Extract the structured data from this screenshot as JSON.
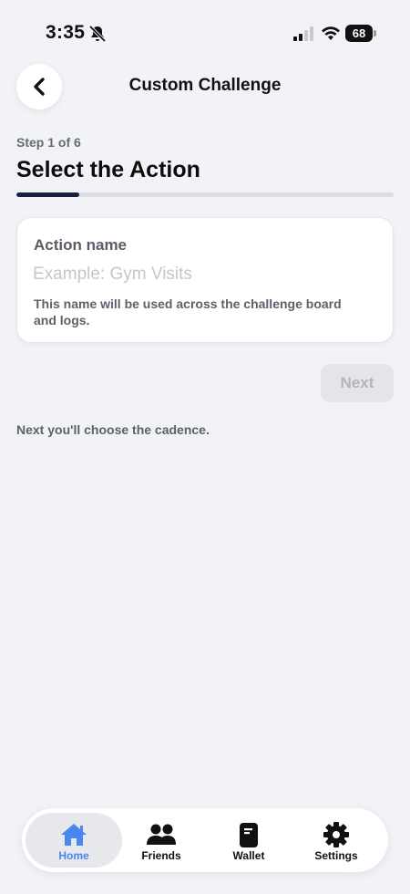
{
  "status_bar": {
    "time": "3:35",
    "battery": "68",
    "icons": [
      "bell-slash-icon",
      "signal-icon",
      "wifi-icon",
      "battery-icon"
    ]
  },
  "header": {
    "title": "Custom Challenge",
    "back_icon": "chevron-left-icon"
  },
  "step": {
    "label": "Step 1 of 6",
    "title": "Select the Action",
    "progress_fraction": 0.1667
  },
  "form": {
    "field_label": "Action name",
    "input_value": "",
    "input_placeholder": "Example: Gym Visits",
    "helper_text": "This name will be used across the challenge board and logs."
  },
  "actions": {
    "next_label": "Next",
    "next_hint": "Next you'll choose the cadence."
  },
  "tab_bar": {
    "items": [
      {
        "label": "Home",
        "icon": "home-icon",
        "active": true
      },
      {
        "label": "Friends",
        "icon": "friends-icon",
        "active": false
      },
      {
        "label": "Wallet",
        "icon": "wallet-icon",
        "active": false
      },
      {
        "label": "Settings",
        "icon": "gear-icon",
        "active": false
      }
    ]
  },
  "colors": {
    "background": "#f2f3f7",
    "accent": "#4a86f0",
    "progress": "#16213e",
    "disabled_button": "#e4e5e9"
  }
}
